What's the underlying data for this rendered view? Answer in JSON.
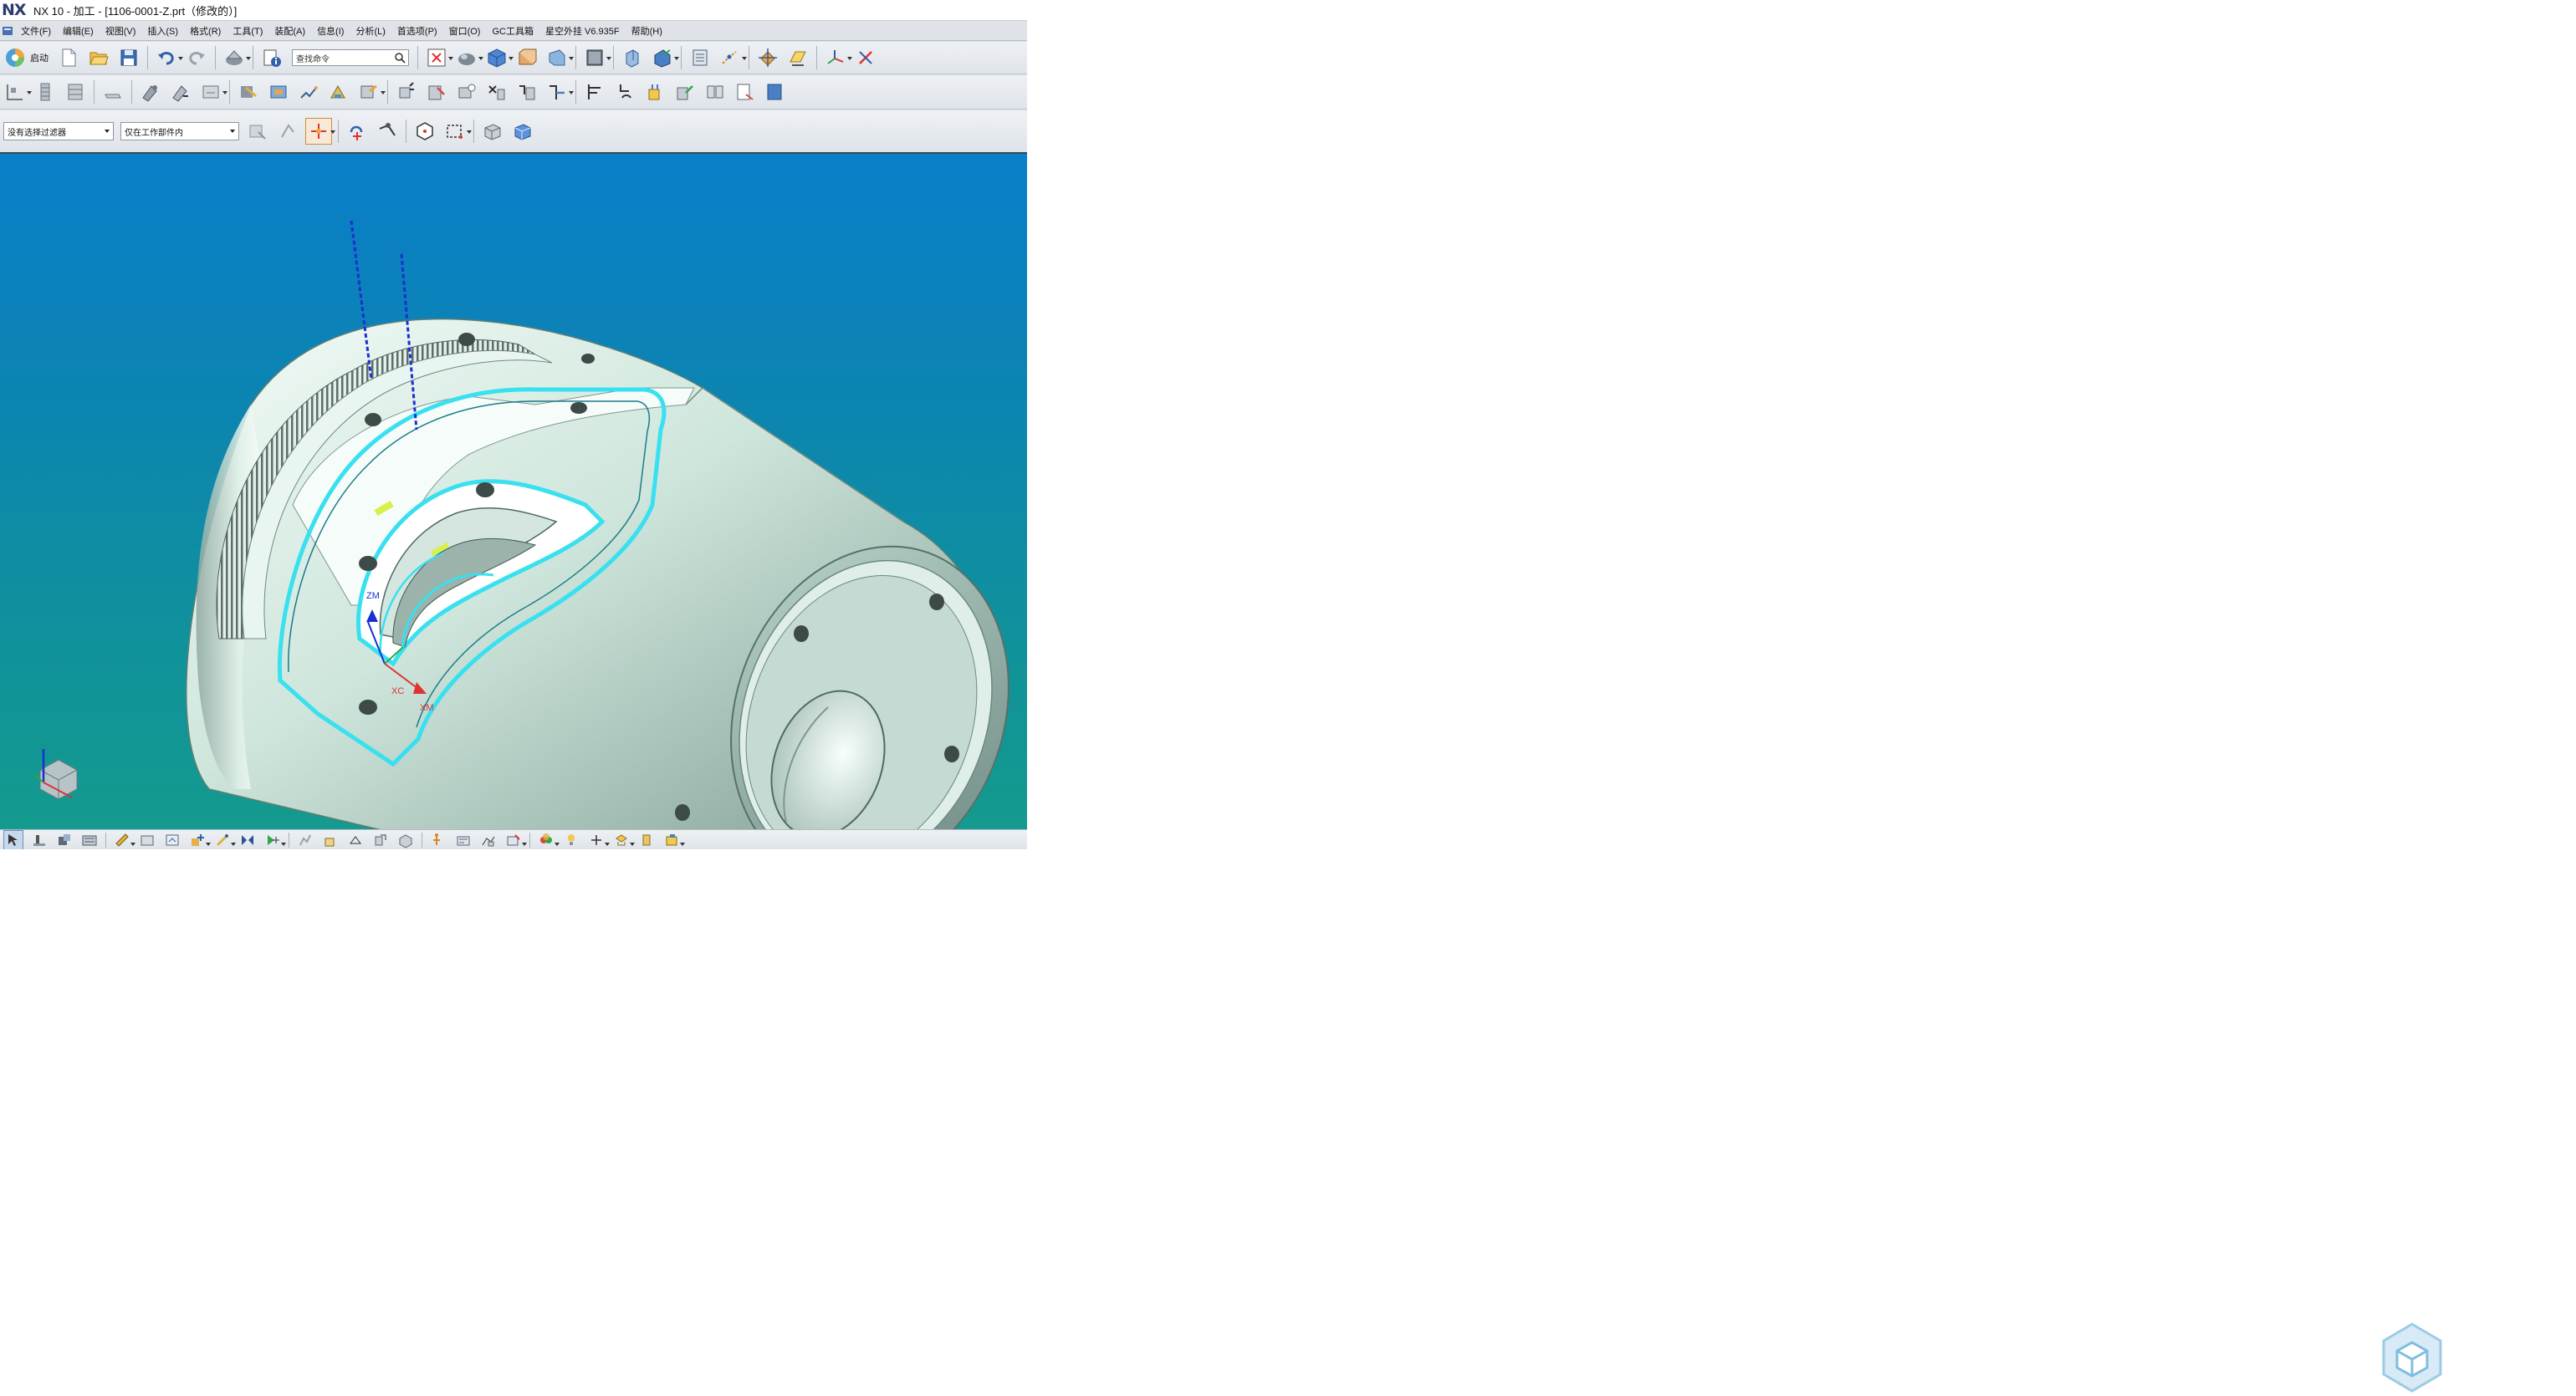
{
  "window": {
    "logo": "NX",
    "title": "NX 10 - 加工 - [1106-0001-Z.prt（修改的）]"
  },
  "menubar": {
    "items": [
      {
        "label": "文件(F)"
      },
      {
        "label": "编辑(E)"
      },
      {
        "label": "视图(V)"
      },
      {
        "label": "插入(S)"
      },
      {
        "label": "格式(R)"
      },
      {
        "label": "工具(T)"
      },
      {
        "label": "装配(A)"
      },
      {
        "label": "信息(I)"
      },
      {
        "label": "分析(L)"
      },
      {
        "label": "首选项(P)"
      },
      {
        "label": "窗口(O)"
      },
      {
        "label": "GC工具箱"
      },
      {
        "label": "星空外挂 V6.935F"
      },
      {
        "label": "帮助(H)"
      }
    ]
  },
  "toolbar": {
    "start_label": "启动",
    "command_search_placeholder": "查找命令"
  },
  "selection_bar": {
    "type_filter": "没有选择过滤器",
    "scope_filter": "仅在工作部件内"
  },
  "viewport": {
    "csys_labels": {
      "zm": "ZM",
      "xc": "XC",
      "xm": "XM"
    },
    "colors": {
      "bg_top": "#0a7ec9",
      "bg_bottom": "#149a8e",
      "part_body": "#c8e2d6",
      "highlight_path": "#38e0f0",
      "tool_axis": "#1a2fd0"
    }
  },
  "icons": {
    "toolbar_row1": [
      "start-icon",
      "new-file-icon",
      "open-folder-icon",
      "save-icon",
      "undo-icon",
      "redo-icon",
      "shade-view-icon",
      "info-icon",
      "fit-view-icon",
      "shaded-solid-icon",
      "cube-view-icon",
      "box-edges-icon",
      "box-icon",
      "layer-display-icon",
      "orient-icon",
      "snap-view-icon",
      "layer-list-icon",
      "point-dialog-icon",
      "move-object-icon",
      "transform-icon",
      "view-triad-icon",
      "clip-icon"
    ],
    "toolbar_row2": [
      "create-program-icon",
      "create-tool-icon",
      "create-geometry-icon",
      "create-method-icon",
      "create-operation-icon",
      "generate-path-icon",
      "replay-path-icon",
      "verify-path-icon",
      "list-path-icon",
      "simulate-icon",
      "postprocess-icon",
      "shop-doc-icon",
      "output-cls-icon",
      "machine-tool-icon",
      "feature-icon",
      "op-navigator-icon",
      "tool-navigator-icon",
      "geometry-navigator-icon",
      "method-navigator-icon",
      "program-order-icon",
      "clip-board-icon",
      "batch-icon",
      "compare-icon",
      "report-icon",
      "export-icon"
    ],
    "toolbar_row3": [
      "select-all-icon",
      "deselect-icon",
      "snap-point-icon",
      "rotate-icon",
      "pan-icon",
      "polygon-icon",
      "rectangle-select-icon",
      "shaded-cube-icon",
      "cube-view-icon"
    ],
    "bottom_bar": [
      "select-icon",
      "part-icon",
      "assembly-icon",
      "constraint-icon",
      "measure-icon",
      "layer-icon",
      "wcs-icon",
      "add-component-icon",
      "snap-icon",
      "mirror-icon",
      "point-icon",
      "plane-icon",
      "move-icon",
      "box-icon",
      "pin-icon",
      "arrange-icon",
      "route-icon",
      "palette-icon",
      "light-icon",
      "axis-icon",
      "material-icon",
      "render-icon",
      "stock-icon",
      "library-icon"
    ]
  }
}
